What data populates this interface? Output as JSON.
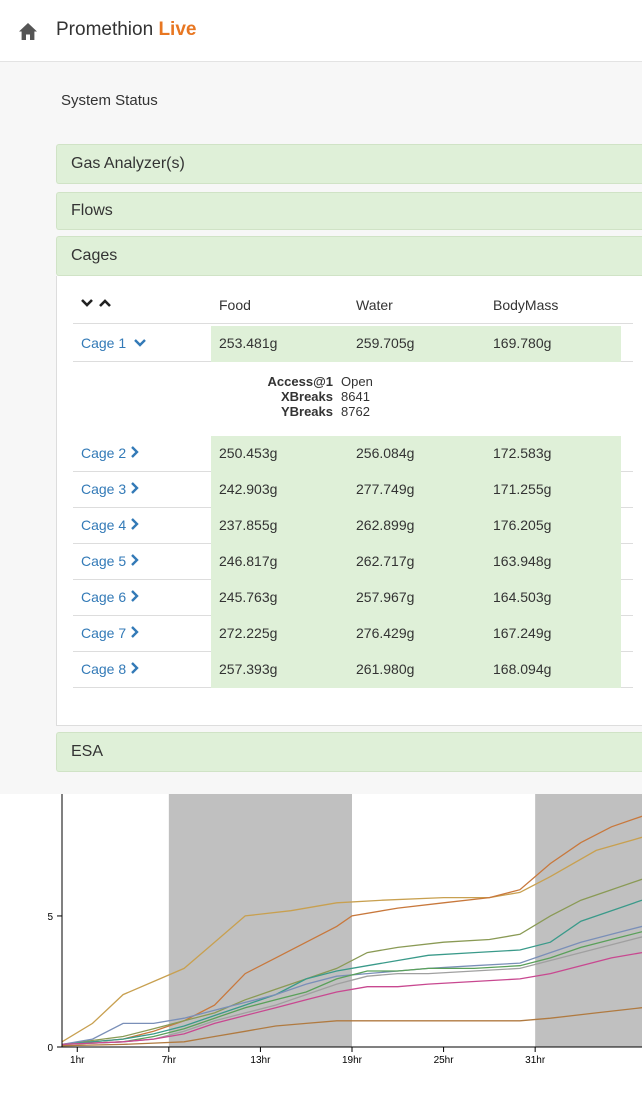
{
  "header": {
    "brand_main": "Promethion",
    "brand_accent": "Live"
  },
  "main": {
    "section_label": "System Status",
    "accordions": {
      "gas": "Gas Analyzer(s)",
      "flows": "Flows",
      "cages": "Cages",
      "esa": "ESA"
    },
    "table": {
      "columns": [
        "Food",
        "Water",
        "BodyMass"
      ],
      "rows": [
        {
          "name": "Cage 1",
          "food": "253.481g",
          "water": "259.705g",
          "mass": "169.780g",
          "expanded": true
        },
        {
          "name": "Cage 2",
          "food": "250.453g",
          "water": "256.084g",
          "mass": "172.583g"
        },
        {
          "name": "Cage 3",
          "food": "242.903g",
          "water": "277.749g",
          "mass": "171.255g"
        },
        {
          "name": "Cage 4",
          "food": "237.855g",
          "water": "262.899g",
          "mass": "176.205g"
        },
        {
          "name": "Cage 5",
          "food": "246.817g",
          "water": "262.717g",
          "mass": "163.948g"
        },
        {
          "name": "Cage 6",
          "food": "245.763g",
          "water": "257.967g",
          "mass": "164.503g"
        },
        {
          "name": "Cage 7",
          "food": "272.225g",
          "water": "276.429g",
          "mass": "167.249g"
        },
        {
          "name": "Cage 8",
          "food": "257.393g",
          "water": "261.980g",
          "mass": "168.094g"
        }
      ],
      "details": {
        "labels": [
          "Access@1",
          "XBreaks",
          "YBreaks"
        ],
        "values": [
          "Open",
          "8641",
          "8762"
        ]
      }
    }
  },
  "colors": {
    "accent": "#e87722",
    "link": "#337ab7",
    "panel_green": "#dff0d8",
    "night_band": "#c0c0c0"
  },
  "icons": {
    "home": "home-icon",
    "expand": "chevron-down-icon",
    "collapse": "chevron-right-icon"
  },
  "chart_data": {
    "type": "line",
    "xlabel": "",
    "ylabel": "",
    "x_ticks": [
      "1hr",
      "7hr",
      "13hr",
      "19hr",
      "25hr",
      "31hr"
    ],
    "y_ticks": [
      "0",
      "5"
    ],
    "xlim": [
      0,
      38
    ],
    "ylim": [
      0,
      9.5
    ],
    "dark_periods": [
      [
        7,
        19
      ],
      [
        31,
        38
      ]
    ],
    "series": [
      {
        "color": "#c8a050",
        "points": [
          [
            0,
            0.2
          ],
          [
            2,
            0.9
          ],
          [
            4,
            2.0
          ],
          [
            6,
            2.5
          ],
          [
            8,
            3.0
          ],
          [
            10,
            4.0
          ],
          [
            12,
            5.0
          ],
          [
            15,
            5.2
          ],
          [
            18,
            5.5
          ],
          [
            21,
            5.6
          ],
          [
            25,
            5.7
          ],
          [
            28,
            5.7
          ],
          [
            30,
            5.9
          ],
          [
            32,
            6.5
          ],
          [
            35,
            7.5
          ],
          [
            38,
            8.0
          ]
        ]
      },
      {
        "color": "#c8783c",
        "points": [
          [
            0,
            0.1
          ],
          [
            4,
            0.3
          ],
          [
            6,
            0.6
          ],
          [
            8,
            1.0
          ],
          [
            10,
            1.6
          ],
          [
            12,
            2.8
          ],
          [
            14,
            3.4
          ],
          [
            16,
            4.0
          ],
          [
            18,
            4.6
          ],
          [
            19,
            5.0
          ],
          [
            22,
            5.3
          ],
          [
            25,
            5.5
          ],
          [
            28,
            5.7
          ],
          [
            30,
            6.0
          ],
          [
            32,
            7.0
          ],
          [
            34,
            7.8
          ],
          [
            36,
            8.4
          ],
          [
            38,
            8.8
          ]
        ]
      },
      {
        "color": "#8a9a55",
        "points": [
          [
            0,
            0.1
          ],
          [
            4,
            0.4
          ],
          [
            6,
            0.7
          ],
          [
            8,
            1.0
          ],
          [
            10,
            1.3
          ],
          [
            12,
            1.8
          ],
          [
            14,
            2.2
          ],
          [
            16,
            2.6
          ],
          [
            18,
            3.0
          ],
          [
            20,
            3.6
          ],
          [
            22,
            3.8
          ],
          [
            25,
            4.0
          ],
          [
            28,
            4.1
          ],
          [
            30,
            4.3
          ],
          [
            32,
            5.0
          ],
          [
            34,
            5.6
          ],
          [
            36,
            6.0
          ],
          [
            38,
            6.4
          ]
        ]
      },
      {
        "color": "#3a9a8a",
        "points": [
          [
            0,
            0.1
          ],
          [
            4,
            0.3
          ],
          [
            6,
            0.5
          ],
          [
            8,
            0.8
          ],
          [
            10,
            1.2
          ],
          [
            12,
            1.6
          ],
          [
            14,
            2.0
          ],
          [
            16,
            2.6
          ],
          [
            18,
            2.9
          ],
          [
            20,
            3.1
          ],
          [
            22,
            3.3
          ],
          [
            24,
            3.5
          ],
          [
            27,
            3.6
          ],
          [
            30,
            3.7
          ],
          [
            32,
            4.0
          ],
          [
            34,
            4.8
          ],
          [
            36,
            5.2
          ],
          [
            38,
            5.6
          ]
        ]
      },
      {
        "color": "#7a8fb8",
        "points": [
          [
            0,
            0.1
          ],
          [
            2,
            0.3
          ],
          [
            4,
            0.9
          ],
          [
            6,
            0.9
          ],
          [
            8,
            1.1
          ],
          [
            10,
            1.4
          ],
          [
            12,
            1.7
          ],
          [
            14,
            2.0
          ],
          [
            16,
            2.4
          ],
          [
            18,
            2.7
          ],
          [
            20,
            2.8
          ],
          [
            22,
            2.9
          ],
          [
            24,
            3.0
          ],
          [
            27,
            3.1
          ],
          [
            30,
            3.2
          ],
          [
            32,
            3.6
          ],
          [
            34,
            4.0
          ],
          [
            36,
            4.3
          ],
          [
            38,
            4.6
          ]
        ]
      },
      {
        "color": "#5aa05a",
        "points": [
          [
            0,
            0.1
          ],
          [
            4,
            0.2
          ],
          [
            6,
            0.4
          ],
          [
            8,
            0.7
          ],
          [
            10,
            1.1
          ],
          [
            12,
            1.5
          ],
          [
            14,
            1.8
          ],
          [
            16,
            2.1
          ],
          [
            18,
            2.6
          ],
          [
            20,
            2.9
          ],
          [
            22,
            2.9
          ],
          [
            24,
            3.0
          ],
          [
            27,
            3.0
          ],
          [
            30,
            3.1
          ],
          [
            32,
            3.4
          ],
          [
            34,
            3.8
          ],
          [
            36,
            4.1
          ],
          [
            38,
            4.4
          ]
        ]
      },
      {
        "color": "#a0a0a0",
        "points": [
          [
            0,
            0.1
          ],
          [
            4,
            0.2
          ],
          [
            6,
            0.3
          ],
          [
            8,
            0.6
          ],
          [
            10,
            1.0
          ],
          [
            12,
            1.3
          ],
          [
            14,
            1.6
          ],
          [
            16,
            2.0
          ],
          [
            18,
            2.4
          ],
          [
            20,
            2.7
          ],
          [
            22,
            2.8
          ],
          [
            24,
            2.8
          ],
          [
            27,
            2.9
          ],
          [
            30,
            3.0
          ],
          [
            32,
            3.3
          ],
          [
            34,
            3.6
          ],
          [
            36,
            3.9
          ],
          [
            38,
            4.2
          ]
        ]
      },
      {
        "color": "#c84890",
        "points": [
          [
            0,
            0.1
          ],
          [
            4,
            0.2
          ],
          [
            6,
            0.3
          ],
          [
            8,
            0.5
          ],
          [
            10,
            0.9
          ],
          [
            12,
            1.2
          ],
          [
            14,
            1.5
          ],
          [
            16,
            1.8
          ],
          [
            18,
            2.1
          ],
          [
            20,
            2.3
          ],
          [
            22,
            2.3
          ],
          [
            24,
            2.4
          ],
          [
            27,
            2.5
          ],
          [
            30,
            2.6
          ],
          [
            32,
            2.8
          ],
          [
            34,
            3.1
          ],
          [
            36,
            3.4
          ],
          [
            38,
            3.6
          ]
        ]
      },
      {
        "color": "#b07a40",
        "points": [
          [
            0,
            0.05
          ],
          [
            4,
            0.1
          ],
          [
            6,
            0.15
          ],
          [
            8,
            0.2
          ],
          [
            10,
            0.4
          ],
          [
            12,
            0.6
          ],
          [
            14,
            0.8
          ],
          [
            16,
            0.9
          ],
          [
            18,
            1.0
          ],
          [
            22,
            1.0
          ],
          [
            26,
            1.0
          ],
          [
            30,
            1.0
          ],
          [
            32,
            1.1
          ],
          [
            35,
            1.3
          ],
          [
            38,
            1.5
          ]
        ]
      }
    ]
  }
}
